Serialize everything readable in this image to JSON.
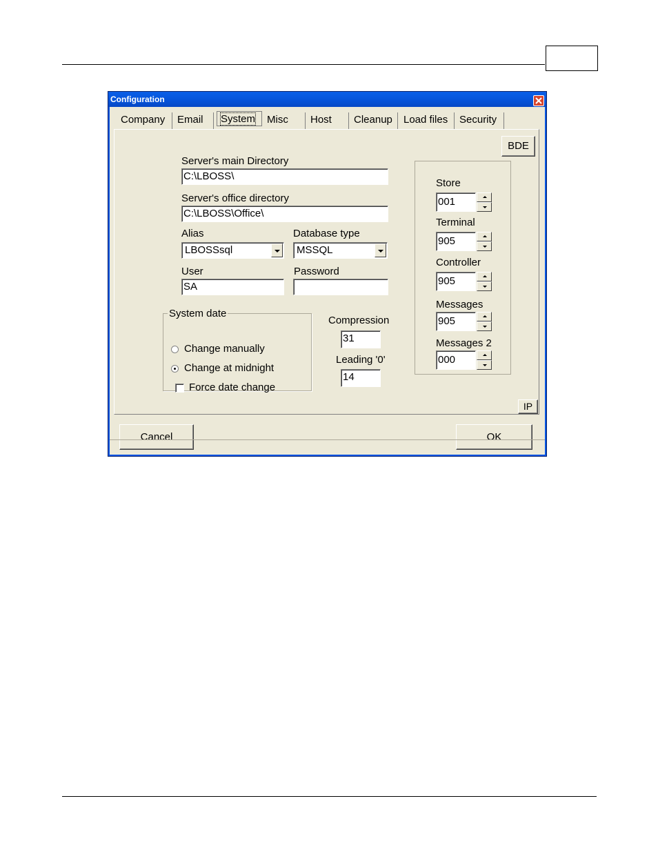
{
  "window": {
    "title": "Configuration"
  },
  "tabs": [
    {
      "label": "Company"
    },
    {
      "label": "Email"
    },
    {
      "label": "System",
      "active": true
    },
    {
      "label": "Misc"
    },
    {
      "label": "Host"
    },
    {
      "label": "Cleanup"
    },
    {
      "label": "Load files"
    },
    {
      "label": "Security"
    }
  ],
  "system": {
    "main_dir": {
      "label": "Server's main Directory",
      "value": "C:\\LBOSS\\"
    },
    "office_dir": {
      "label": "Server's office directory",
      "value": "C:\\LBOSS\\Office\\"
    },
    "alias": {
      "label": "Alias",
      "value": "LBOSSsql"
    },
    "db_type": {
      "label": "Database type",
      "value": "MSSQL"
    },
    "user": {
      "label": "User",
      "value": "SA"
    },
    "password": {
      "label": "Password",
      "value": ""
    },
    "system_date": {
      "legend": "System date",
      "change_manually": "Change manually",
      "change_midnight": "Change at midnight",
      "force_change": "Force date change",
      "selected": "Change at midnight",
      "force_checked": false
    },
    "compression": {
      "label": "Compression",
      "value": "31"
    },
    "leading": {
      "label": "Leading '0'",
      "value": "14"
    },
    "store": {
      "label": "Store",
      "value": "001"
    },
    "terminal": {
      "label": "Terminal",
      "value": "905"
    },
    "controller": {
      "label": "Controller",
      "value": "905"
    },
    "messages": {
      "label": "Messages",
      "value": "905"
    },
    "messages2": {
      "label": "Messages 2",
      "value": "000"
    },
    "bde_label": "BDE",
    "ip_label": "IP"
  },
  "buttons": {
    "cancel": "Cancel",
    "ok": "OK"
  }
}
